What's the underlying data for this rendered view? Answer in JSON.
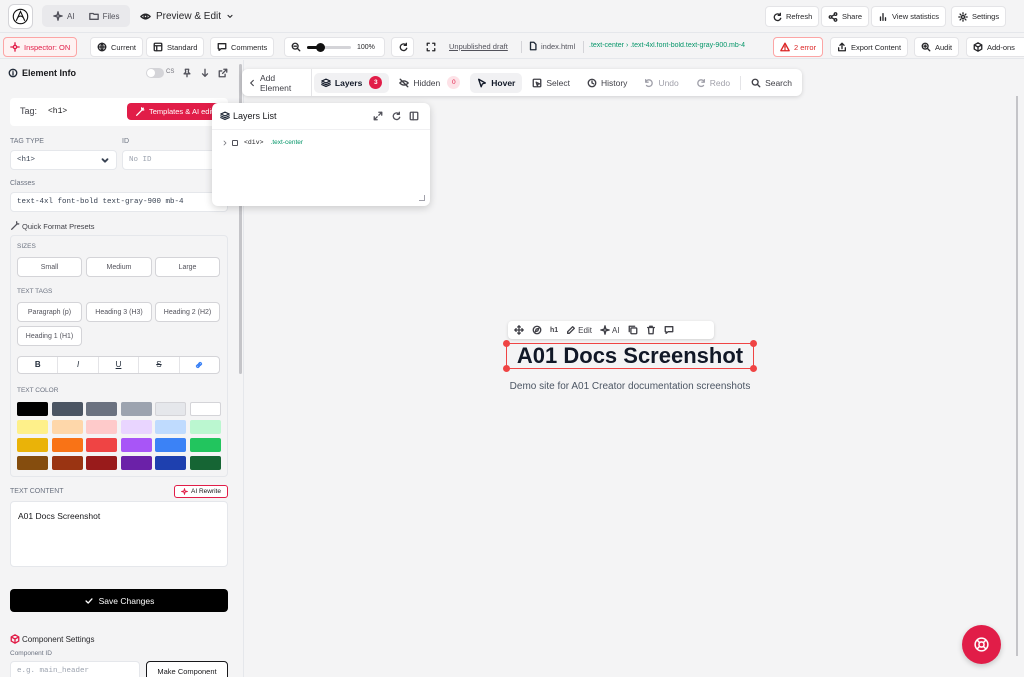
{
  "topbar": {
    "tabs": [
      {
        "label": "AI",
        "icon": "sparkles-icon"
      },
      {
        "label": "Files",
        "icon": "folder-icon"
      }
    ],
    "preview_label": "Preview & Edit",
    "actions": [
      {
        "label": "Refresh",
        "icon": "refresh-icon"
      },
      {
        "label": "Share",
        "icon": "share-icon"
      },
      {
        "label": "View statistics",
        "icon": "chart-icon"
      },
      {
        "label": "Settings",
        "icon": "gear-icon"
      }
    ]
  },
  "bar2": {
    "inspector": "Inspector: ON",
    "current": "Current",
    "standard": "Standard",
    "comments": "Comments",
    "zoom": "100%",
    "zoom_level": 0.3,
    "unpublished": "Unpublished draft",
    "file": "index.html",
    "breadcrumb": ".text-center › .text-4xl.font-bold.text-gray-900.mb-4",
    "error": "2 error",
    "export": "Export Content",
    "audit": "Audit",
    "addons": "Add-ons"
  },
  "left": {
    "title": "Element Info",
    "css_toggle": "CS",
    "tag_label": "Tag:",
    "tag_value": "<h1>",
    "templates_btn": "Templates & AI edit",
    "tag_type_label": "TAG TYPE",
    "tag_type_value": "<h1>",
    "id_label": "ID",
    "id_placeholder": "No ID",
    "classes_label": "Classes",
    "classes_value": "text-4xl font-bold text-gray-900 mb-4",
    "quick_presets": "Quick Format Presets",
    "sizes_label": "SIZES",
    "sizes": [
      "Small",
      "Medium",
      "Large"
    ],
    "text_tags_label": "TEXT TAGS",
    "text_tags": [
      "Paragraph (p)",
      "Heading 3 (H3)",
      "Heading 2 (H2)",
      "Heading 1 (H1)"
    ],
    "format": [
      "B",
      "I",
      "U",
      "S"
    ],
    "text_color_label": "TEXT COLOR",
    "colors": [
      "#000000",
      "#4b5563",
      "#6b7280",
      "#9ca3af",
      "#e5e7eb",
      "#ffffff",
      "#fef08a",
      "#fed7aa",
      "#fecaca",
      "#e9d5ff",
      "#bfdbfe",
      "#bbf7d0",
      "#eab308",
      "#f97316",
      "#ef4444",
      "#a855f7",
      "#3b82f6",
      "#22c55e",
      "#854d0e",
      "#9a3412",
      "#991b1b",
      "#6b21a8",
      "#1e40af",
      "#166534"
    ],
    "text_content_label": "TEXT CONTENT",
    "ai_rewrite": "AI Rewrite",
    "text_content_value": "A01 Docs Screenshot",
    "save_btn": "Save Changes",
    "component_settings": "Component Settings",
    "component_id_label": "Component ID",
    "component_id_placeholder": "e.g. main_header",
    "make_component": "Make Component"
  },
  "floating_toolbar": {
    "add_element": "Add Element",
    "layers": "Layers",
    "layers_count": "3",
    "hidden": "Hidden",
    "hidden_count": "0",
    "hover": "Hover",
    "select": "Select",
    "history": "History",
    "undo": "Undo",
    "redo": "Redo",
    "search": "Search"
  },
  "layers_panel": {
    "title": "Layers List",
    "item_tag": "<div>",
    "item_class": ".text-center"
  },
  "canvas": {
    "heading": "A01 Docs Screenshot",
    "subtitle": "Demo site for A01 Creator documentation screenshots",
    "element_toolbar": {
      "tag": "h1",
      "edit": "Edit",
      "ai": "AI"
    }
  },
  "accent": "#e11d48",
  "green": "#059669"
}
